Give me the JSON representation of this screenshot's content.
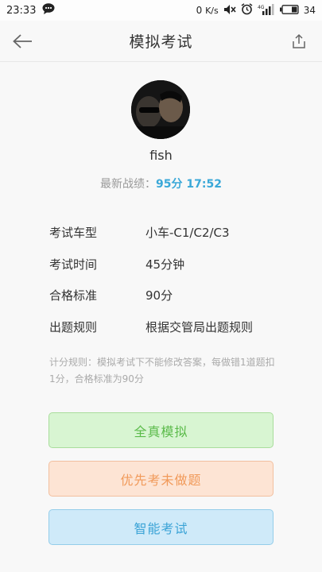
{
  "status_bar": {
    "time": "23:33",
    "net_speed_value": "0",
    "net_speed_unit": "K/s",
    "network_type": "4G",
    "battery": "34"
  },
  "header": {
    "title": "模拟考试",
    "back_icon": "arrow-left-icon",
    "share_icon": "share-icon"
  },
  "profile": {
    "username": "fish",
    "latest_label": "最新战绩：",
    "latest_score": "95分 17:52"
  },
  "exam_info": [
    {
      "label": "考试车型",
      "value": "小车-C1/C2/C3"
    },
    {
      "label": "考试时间",
      "value": "45分钟"
    },
    {
      "label": "合格标准",
      "value": "90分"
    },
    {
      "label": "出题规则",
      "value": "根据交管局出题规则"
    }
  ],
  "rule_note": "计分规则：模拟考试下不能修改答案，每做错1道题扣1分，合格标准为90分",
  "actions": {
    "full_sim": "全真模拟",
    "priority_undone": "优先考未做题",
    "smart_exam": "智能考试"
  },
  "colors": {
    "accent_blue": "#3aa8d8",
    "green": "#5bbb4a",
    "orange": "#f19a5a",
    "blue": "#3aa3d6"
  }
}
